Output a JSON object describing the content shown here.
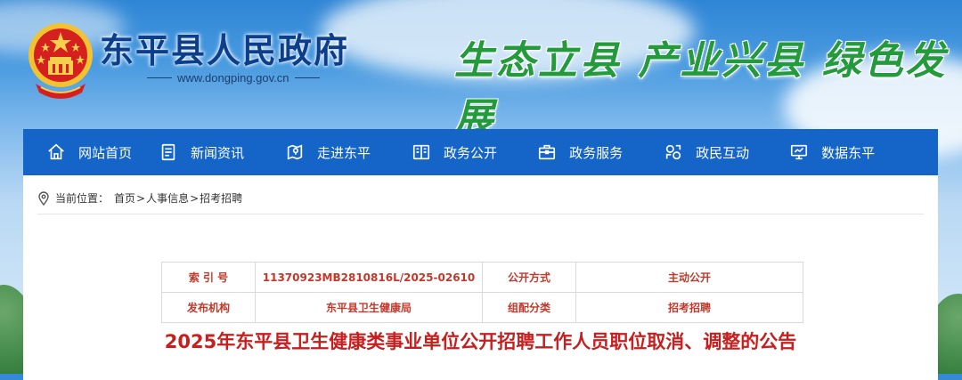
{
  "site": {
    "title": "东平县人民政府",
    "url": "www.dongping.gov.cn",
    "slogan": "生态立县  产业兴县  绿色发展"
  },
  "nav": {
    "items": [
      {
        "label": "网站首页",
        "icon": "home-icon"
      },
      {
        "label": "新闻资讯",
        "icon": "news-icon"
      },
      {
        "label": "走进东平",
        "icon": "map-icon"
      },
      {
        "label": "政务公开",
        "icon": "book-icon"
      },
      {
        "label": "政务服务",
        "icon": "briefcase-icon"
      },
      {
        "label": "政民互动",
        "icon": "interaction-icon"
      },
      {
        "label": "数据东平",
        "icon": "monitor-icon"
      }
    ]
  },
  "breadcrumb": {
    "prefix": "当前位置：",
    "items": [
      "首页",
      "人事信息",
      "招考招聘"
    ],
    "separator": ">"
  },
  "meta_table": {
    "rows": [
      [
        {
          "k": "索 引 号"
        },
        {
          "v": "11370923MB2810816L/2025-02610"
        },
        {
          "k": "公开方式"
        },
        {
          "v": "主动公开"
        }
      ],
      [
        {
          "k": "发布机构"
        },
        {
          "v": "东平县卫生健康局"
        },
        {
          "k": "组配分类"
        },
        {
          "v": "招考招聘"
        }
      ]
    ]
  },
  "document": {
    "title": "2025年东平县卫生健康类事业单位公开招聘工作人员职位取消、调整的公告"
  },
  "colors": {
    "nav_bg": "#1565c8",
    "title_blue": "#0d3e8c",
    "slogan_green": "#239a3b",
    "accent_red": "#c81e1e"
  }
}
